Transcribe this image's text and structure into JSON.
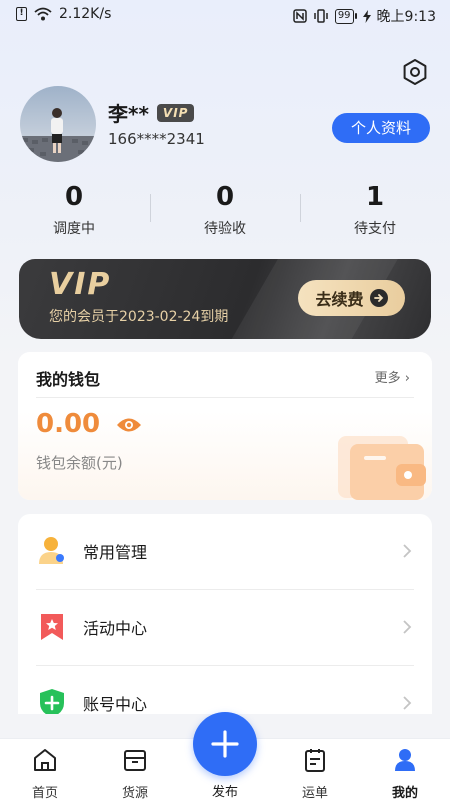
{
  "status_bar": {
    "network_speed": "2.12K/s",
    "battery_level": "99",
    "time": "晚上9:13"
  },
  "profile": {
    "name": "李**",
    "vip_badge": "VIP",
    "phone": "166****2341",
    "profile_button": "个人资料"
  },
  "stats": [
    {
      "value": "0",
      "label": "调度中"
    },
    {
      "value": "0",
      "label": "待验收"
    },
    {
      "value": "1",
      "label": "待支付"
    }
  ],
  "vip_card": {
    "title": "VIP",
    "expire_text": "您的会员于2023-02-24到期",
    "renew_button": "去续费"
  },
  "wallet": {
    "title": "我的钱包",
    "more": "更多",
    "balance": "0.00",
    "balance_label": "钱包余额(元)"
  },
  "menu": [
    {
      "label": "常用管理",
      "icon": "person-icon"
    },
    {
      "label": "活动中心",
      "icon": "bookmark-star-icon"
    },
    {
      "label": "账号中心",
      "icon": "shield-plus-icon"
    }
  ],
  "bottom_nav": {
    "items": [
      {
        "label": "首页",
        "icon": "home-icon"
      },
      {
        "label": "货源",
        "icon": "box-icon"
      },
      {
        "label": "运单",
        "icon": "document-icon"
      },
      {
        "label": "我的",
        "icon": "user-icon"
      }
    ],
    "publish_label": "发布",
    "active": "我的"
  },
  "colors": {
    "accent": "#2f6df6",
    "balance": "#ef8b3b",
    "vip_gold": "#e9cf9f"
  }
}
